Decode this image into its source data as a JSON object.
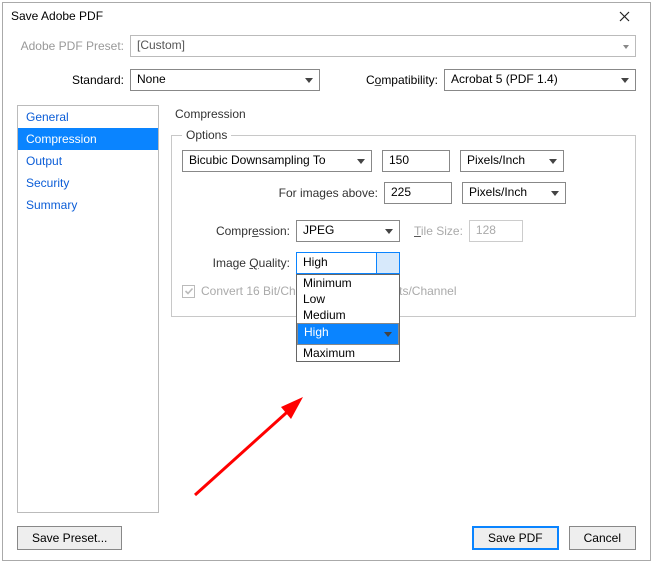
{
  "window": {
    "title": "Save Adobe PDF"
  },
  "preset": {
    "label": "Adobe PDF Preset:",
    "value": "[Custom]"
  },
  "standard": {
    "label": "Standard:",
    "value": "None",
    "compat_label_pre": "C",
    "compat_label_mid": "o",
    "compat_label_post": "mpatibility:",
    "compat_value": "Acrobat 5 (PDF 1.4)"
  },
  "sidebar": {
    "items": [
      {
        "label": "General"
      },
      {
        "label": "Compression"
      },
      {
        "label": "Output"
      },
      {
        "label": "Security"
      },
      {
        "label": "Summary"
      }
    ],
    "active_index": 1
  },
  "page": {
    "title": "Compression"
  },
  "options": {
    "legend": "Options",
    "downsample": {
      "method": "Bicubic Downsampling To",
      "value": "150",
      "unit": "Pixels/Inch"
    },
    "above": {
      "label": "For images above:",
      "value": "225",
      "unit": "Pixels/Inch"
    },
    "compress": {
      "label_pre": "Compr",
      "label_mid": "e",
      "label_post": "ssion:",
      "value": "JPEG",
      "tile_label": "Tile Size:",
      "tile_value": "128"
    },
    "quality": {
      "label_pre": "Image ",
      "label_mid": "Q",
      "label_post": "uality:",
      "value": "High",
      "options": [
        "Minimum",
        "Low",
        "Medium",
        "High",
        "Maximum"
      ],
      "selected_index": 3
    },
    "convert16": "Convert 16 Bit/Channel Image to 8 Bits/Channel"
  },
  "footer": {
    "save_preset": "Save Preset...",
    "save_pdf": "Save PDF",
    "cancel": "Cancel"
  }
}
